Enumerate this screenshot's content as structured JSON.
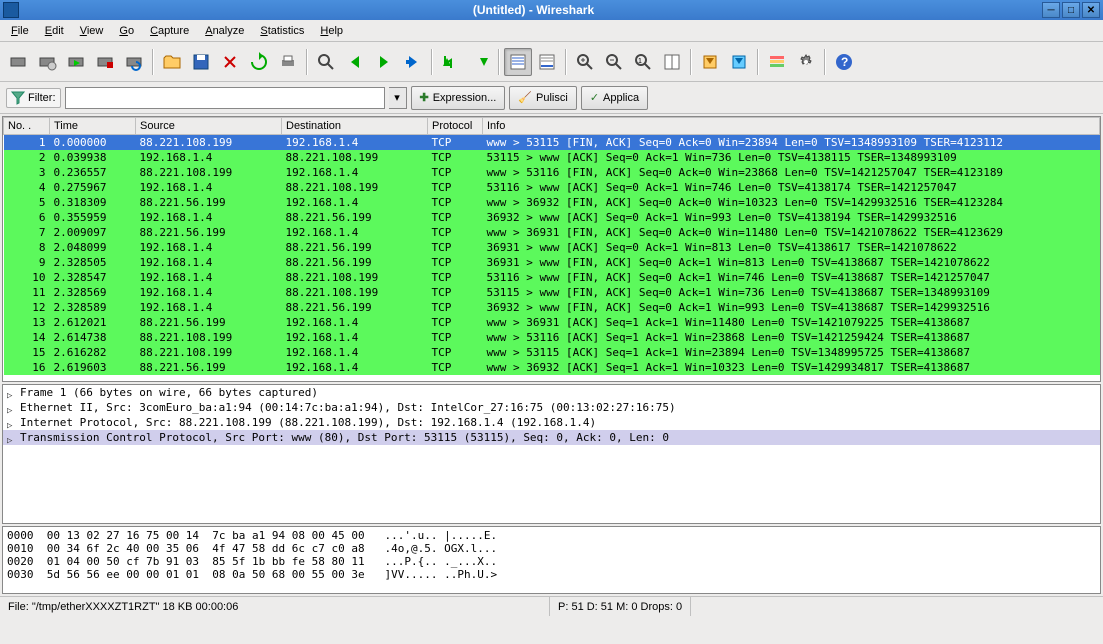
{
  "titlebar": {
    "title": "(Untitled) - Wireshark"
  },
  "menus": [
    "File",
    "Edit",
    "View",
    "Go",
    "Capture",
    "Analyze",
    "Statistics",
    "Help"
  ],
  "toolbar_icons": [
    [
      "interfaces-icon",
      "capture-options-icon",
      "capture-start-icon",
      "capture-stop-icon",
      "capture-restart-icon"
    ],
    [
      "open-file-icon",
      "save-icon",
      "close-icon",
      "reload-icon",
      "print-icon"
    ],
    [
      "find-icon",
      "go-back-icon",
      "go-forward-icon",
      "go-to-icon"
    ],
    [
      "go-first-icon",
      "go-last-icon"
    ],
    [
      "colorize-icon",
      "auto-scroll-icon"
    ],
    [
      "zoom-in-icon",
      "zoom-out-icon",
      "zoom-reset-icon",
      "resize-columns-icon"
    ],
    [
      "capture-filters-icon",
      "display-filters-icon"
    ],
    [
      "coloring-rules-icon",
      "preferences-icon"
    ],
    [
      "help-icon"
    ]
  ],
  "filter": {
    "label": "Filter:",
    "value": "",
    "expression_btn": "Expression...",
    "clear_btn": "Pulisci",
    "apply_btn": "Applica"
  },
  "columns": [
    "No. .",
    "Time",
    "Source",
    "Destination",
    "Protocol",
    "Info"
  ],
  "rows": [
    {
      "no": "1",
      "time": "0.000000",
      "src": "88.221.108.199",
      "dst": "192.168.1.4",
      "proto": "TCP",
      "info": "www > 53115 [FIN, ACK] Seq=0 Ack=0 Win=23894 Len=0 TSV=1348993109 TSER=4123112",
      "cls": "sel"
    },
    {
      "no": "2",
      "time": "0.039938",
      "src": "192.168.1.4",
      "dst": "88.221.108.199",
      "proto": "TCP",
      "info": "53115 > www [ACK] Seq=0 Ack=1 Win=736 Len=0 TSV=4138115 TSER=1348993109",
      "cls": "grn"
    },
    {
      "no": "3",
      "time": "0.236557",
      "src": "88.221.108.199",
      "dst": "192.168.1.4",
      "proto": "TCP",
      "info": "www > 53116 [FIN, ACK] Seq=0 Ack=0 Win=23868 Len=0 TSV=1421257047 TSER=4123189",
      "cls": "grn"
    },
    {
      "no": "4",
      "time": "0.275967",
      "src": "192.168.1.4",
      "dst": "88.221.108.199",
      "proto": "TCP",
      "info": "53116 > www [ACK] Seq=0 Ack=1 Win=746 Len=0 TSV=4138174 TSER=1421257047",
      "cls": "grn"
    },
    {
      "no": "5",
      "time": "0.318309",
      "src": "88.221.56.199",
      "dst": "192.168.1.4",
      "proto": "TCP",
      "info": "www > 36932 [FIN, ACK] Seq=0 Ack=0 Win=10323 Len=0 TSV=1429932516 TSER=4123284",
      "cls": "grn"
    },
    {
      "no": "6",
      "time": "0.355959",
      "src": "192.168.1.4",
      "dst": "88.221.56.199",
      "proto": "TCP",
      "info": "36932 > www [ACK] Seq=0 Ack=1 Win=993 Len=0 TSV=4138194 TSER=1429932516",
      "cls": "grn"
    },
    {
      "no": "7",
      "time": "2.009097",
      "src": "88.221.56.199",
      "dst": "192.168.1.4",
      "proto": "TCP",
      "info": "www > 36931 [FIN, ACK] Seq=0 Ack=0 Win=11480 Len=0 TSV=1421078622 TSER=4123629",
      "cls": "grn"
    },
    {
      "no": "8",
      "time": "2.048099",
      "src": "192.168.1.4",
      "dst": "88.221.56.199",
      "proto": "TCP",
      "info": "36931 > www [ACK] Seq=0 Ack=1 Win=813 Len=0 TSV=4138617 TSER=1421078622",
      "cls": "grn"
    },
    {
      "no": "9",
      "time": "2.328505",
      "src": "192.168.1.4",
      "dst": "88.221.56.199",
      "proto": "TCP",
      "info": "36931 > www [FIN, ACK] Seq=0 Ack=1 Win=813 Len=0 TSV=4138687 TSER=1421078622",
      "cls": "grn"
    },
    {
      "no": "10",
      "time": "2.328547",
      "src": "192.168.1.4",
      "dst": "88.221.108.199",
      "proto": "TCP",
      "info": "53116 > www [FIN, ACK] Seq=0 Ack=1 Win=746 Len=0 TSV=4138687 TSER=1421257047",
      "cls": "grn"
    },
    {
      "no": "11",
      "time": "2.328569",
      "src": "192.168.1.4",
      "dst": "88.221.108.199",
      "proto": "TCP",
      "info": "53115 > www [FIN, ACK] Seq=0 Ack=1 Win=736 Len=0 TSV=4138687 TSER=1348993109",
      "cls": "grn"
    },
    {
      "no": "12",
      "time": "2.328589",
      "src": "192.168.1.4",
      "dst": "88.221.56.199",
      "proto": "TCP",
      "info": "36932 > www [FIN, ACK] Seq=0 Ack=1 Win=993 Len=0 TSV=4138687 TSER=1429932516",
      "cls": "grn"
    },
    {
      "no": "13",
      "time": "2.612021",
      "src": "88.221.56.199",
      "dst": "192.168.1.4",
      "proto": "TCP",
      "info": "www > 36931 [ACK] Seq=1 Ack=1 Win=11480 Len=0 TSV=1421079225 TSER=4138687",
      "cls": "grn"
    },
    {
      "no": "14",
      "time": "2.614738",
      "src": "88.221.108.199",
      "dst": "192.168.1.4",
      "proto": "TCP",
      "info": "www > 53116 [ACK] Seq=1 Ack=1 Win=23868 Len=0 TSV=1421259424 TSER=4138687",
      "cls": "grn"
    },
    {
      "no": "15",
      "time": "2.616282",
      "src": "88.221.108.199",
      "dst": "192.168.1.4",
      "proto": "TCP",
      "info": "www > 53115 [ACK] Seq=1 Ack=1 Win=23894 Len=0 TSV=1348995725 TSER=4138687",
      "cls": "grn"
    },
    {
      "no": "16",
      "time": "2.619603",
      "src": "88.221.56.199",
      "dst": "192.168.1.4",
      "proto": "TCP",
      "info": "www > 36932 [ACK] Seq=1 Ack=1 Win=10323 Len=0 TSV=1429934817 TSER=4138687",
      "cls": "grn"
    }
  ],
  "details": [
    {
      "text": "Frame 1 (66 bytes on wire, 66 bytes captured)",
      "sel": false
    },
    {
      "text": "Ethernet II, Src: 3comEuro_ba:a1:94 (00:14:7c:ba:a1:94), Dst: IntelCor_27:16:75 (00:13:02:27:16:75)",
      "sel": false
    },
    {
      "text": "Internet Protocol, Src: 88.221.108.199 (88.221.108.199), Dst: 192.168.1.4 (192.168.1.4)",
      "sel": false
    },
    {
      "text": "Transmission Control Protocol, Src Port: www (80), Dst Port: 53115 (53115), Seq: 0, Ack: 0, Len: 0",
      "sel": true
    }
  ],
  "hex": "0000  00 13 02 27 16 75 00 14  7c ba a1 94 08 00 45 00   ...'.u.. |.....E.\n0010  00 34 6f 2c 40 00 35 06  4f 47 58 dd 6c c7 c0 a8   .4o,@.5. OGX.l...\n0020  01 04 00 50 cf 7b 91 03  85 5f 1b bb fe 58 80 11   ...P.{.. ._...X..\n0030  5d 56 56 ee 00 00 01 01  08 0a 50 68 00 55 00 3e   ]VV..... ..Ph.U.>",
  "status": {
    "file": "File: \"/tmp/etherXXXXZT1RZT\" 18 KB 00:00:06",
    "packets": "P: 51 D: 51 M: 0 Drops: 0"
  }
}
